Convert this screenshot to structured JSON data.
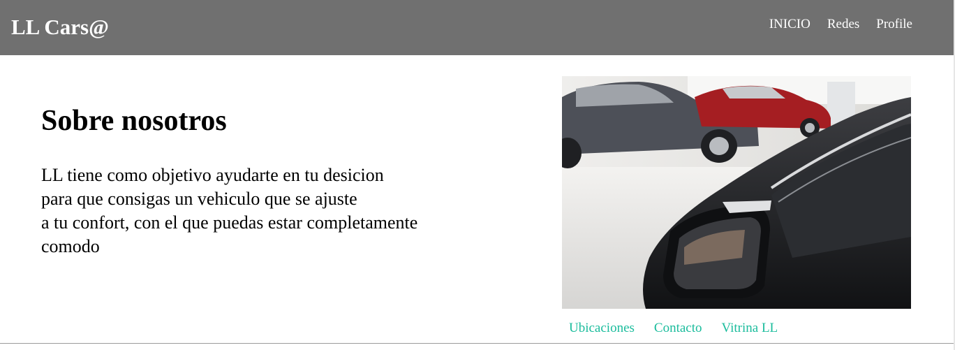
{
  "header": {
    "brand": "LL Cars@",
    "nav": [
      "INICIO",
      "Redes",
      "Profile"
    ]
  },
  "about": {
    "title": "Sobre nosotros",
    "lines": [
      "LL tiene como objetivo ayudarte en tu desicion",
      "para que consigas un vehiculo que se ajuste",
      "a tu confort, con el que puedas estar completamente",
      "comodo"
    ]
  },
  "footer": {
    "links": [
      "Ubicaciones",
      "Contacto",
      "Vitrina LL"
    ]
  },
  "colors": {
    "navbar": "#707070",
    "footer_link": "#1abc9c"
  }
}
